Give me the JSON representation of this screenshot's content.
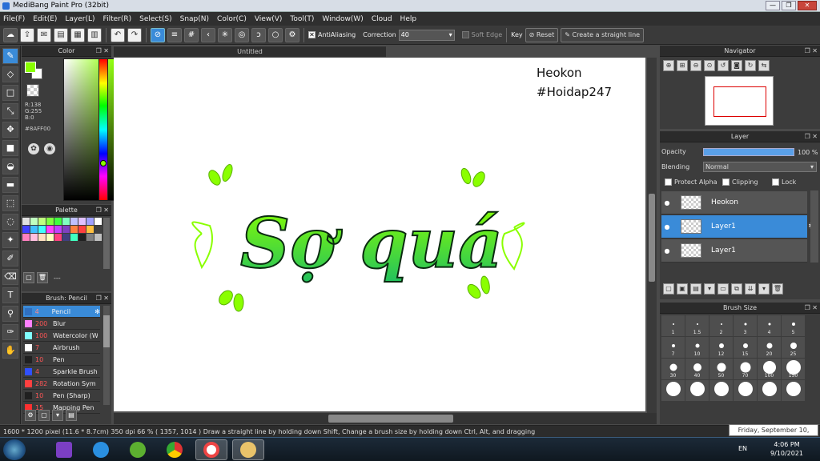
{
  "window": {
    "title": "MediBang Paint Pro (32bit)",
    "min": "—",
    "max": "❐",
    "close": "✕"
  },
  "menu": [
    "File(F)",
    "Edit(E)",
    "Layer(L)",
    "Filter(R)",
    "Select(S)",
    "Snap(N)",
    "Color(C)",
    "View(V)",
    "Tool(T)",
    "Window(W)",
    "Cloud",
    "Help"
  ],
  "toolbar": {
    "antialias_label": "AntiAliasing",
    "correction_label": "Correction",
    "correction_value": "40",
    "soft_edge_label": "Soft Edge",
    "key_label": "Key",
    "reset_label": "Reset",
    "straight_line_label": "Create a straight line"
  },
  "color_panel": {
    "title": "Color",
    "r": "R:138",
    "g": "G:255",
    "b": "B:0",
    "hex": "#8AFF00",
    "fg_color": "#8AFF00",
    "bg_color": "#FFFFFF"
  },
  "palette_panel": {
    "title": "Palette",
    "colors": [
      "#e0e0e0",
      "#c0ffc0",
      "#c0ff80",
      "#80ff40",
      "#40ff40",
      "#80ffc0",
      "#c0c0ff",
      "#e0c0ff",
      "#a0a0ff",
      "#ffffff",
      "#4040ff",
      "#40c0ff",
      "#40ffff",
      "#ff40ff",
      "#c040ff",
      "#8040c0",
      "#ff8040",
      "#ff4040",
      "#ffc040",
      "#404040",
      "#ff80c0",
      "#ffc0e0",
      "#ffe0c0",
      "#ffffc0",
      "#ff4080",
      "#404080",
      "#40ffc0",
      "#202020",
      "#808080",
      "#c0c0c0"
    ],
    "tail": "---"
  },
  "brush_panel": {
    "title": "Brush: Pencil",
    "brushes": [
      {
        "size": "4",
        "name": "Pencil",
        "color": "#3070c0"
      },
      {
        "size": "200",
        "name": "Blur",
        "color": "#ff80ff"
      },
      {
        "size": "100",
        "name": "Watercolor (W",
        "color": "#80ffff"
      },
      {
        "size": "7",
        "name": "Airbrush",
        "color": "#ffffff"
      },
      {
        "size": "10",
        "name": "Pen",
        "color": "#202020"
      },
      {
        "size": "4",
        "name": "Sparkle Brush",
        "color": "#3050ff"
      },
      {
        "size": "282",
        "name": "Rotation Sym",
        "color": "#ff4040"
      },
      {
        "size": "10",
        "name": "Pen (Sharp)",
        "color": "#202020"
      },
      {
        "size": "15",
        "name": "Mapping Pen",
        "color": "#ff3030"
      }
    ]
  },
  "document": {
    "tab_title": "Untitled",
    "text_line1": "Heokon",
    "text_line2": "#Hoidap247",
    "artwork_text": "Sợ quá",
    "art_color_top": "#8aff00",
    "art_color_bottom": "#20c060"
  },
  "navigator": {
    "title": "Navigator"
  },
  "layer_panel": {
    "title": "Layer",
    "opacity_label": "Opacity",
    "opacity_value": "100 %",
    "opacity_fraction": 1.0,
    "blending_label": "Blending",
    "blending_value": "Normal",
    "protect_alpha_label": "Protect Alpha",
    "clipping_label": "Clipping",
    "lock_label": "Lock",
    "layers": [
      {
        "name": "Heokon",
        "selected": false
      },
      {
        "name": "Layer1",
        "selected": true
      },
      {
        "name": "Layer1",
        "selected": false
      }
    ]
  },
  "brush_size_panel": {
    "title": "Brush Size",
    "sizes": [
      "1",
      "1.5",
      "2",
      "3",
      "4",
      "5",
      "7",
      "10",
      "12",
      "15",
      "20",
      "25",
      "30",
      "40",
      "50",
      "70",
      "100",
      "150"
    ]
  },
  "status": {
    "text": "1600 * 1200 pixel   (11.6 * 8.7cm)   350 dpi   66 %   ( 1357, 1014 )   Draw a straight line by holding down Shift, Change a brush size by holding down Ctrl, Alt, and dragging"
  },
  "tooltip": "Friday, September 10, 2021",
  "taskbar": {
    "lang": "EN",
    "time": "4:06 PM",
    "date": "9/10/2021"
  }
}
